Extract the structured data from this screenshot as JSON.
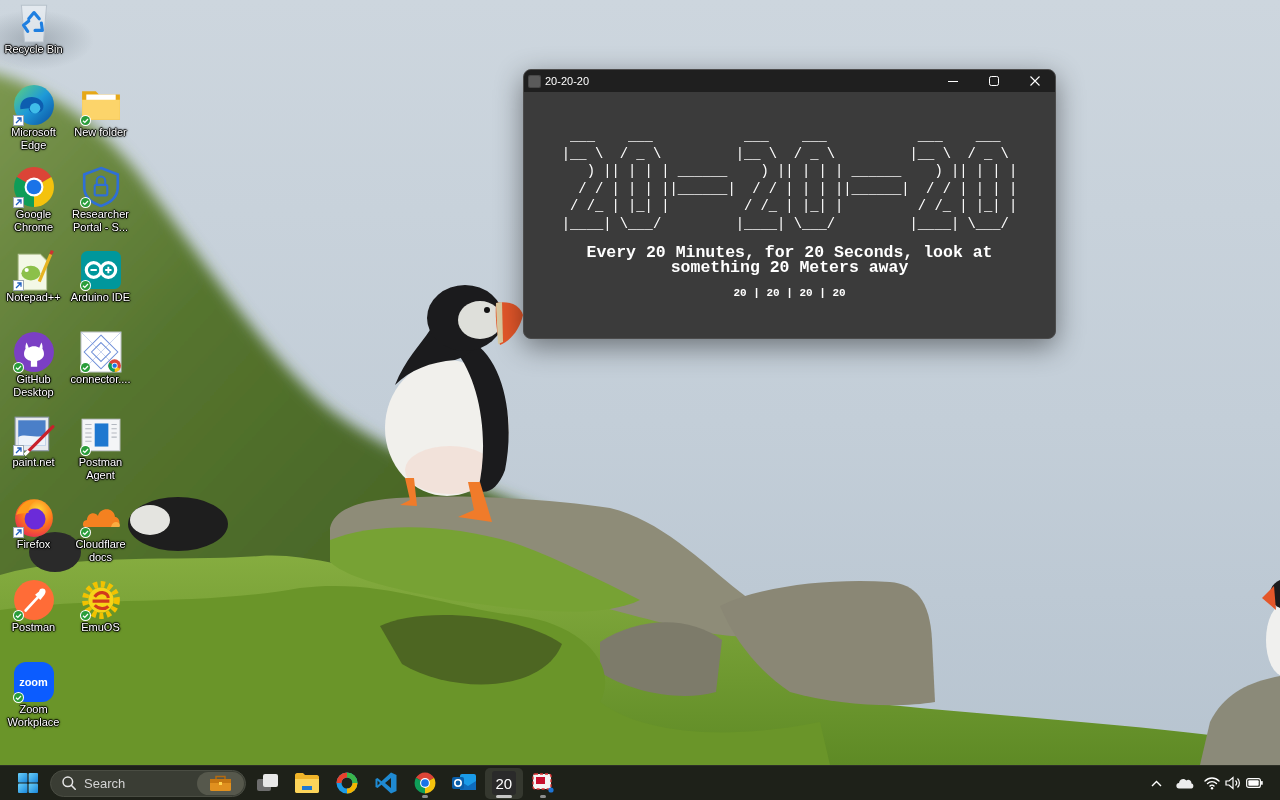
{
  "desktop": {
    "rows": [
      {
        "icons": [
          {
            "label": "Recycle Bin",
            "shortcut": false,
            "synced": false
          }
        ]
      },
      {
        "icons": [
          {
            "label": "Microsoft Edge",
            "shortcut": true,
            "synced": false
          },
          {
            "label": "New folder",
            "shortcut": false,
            "synced": true
          }
        ]
      },
      {
        "icons": [
          {
            "label": "Google Chrome",
            "shortcut": true,
            "synced": false
          },
          {
            "label": "Researcher Portal - S...",
            "shortcut": false,
            "synced": true
          }
        ]
      },
      {
        "icons": [
          {
            "label": "Notepad++",
            "shortcut": true,
            "synced": false
          },
          {
            "label": "Arduino IDE",
            "shortcut": false,
            "synced": true
          }
        ]
      },
      {
        "icons": [
          {
            "label": "GitHub Desktop",
            "shortcut": false,
            "synced": true
          },
          {
            "label": "connector....",
            "shortcut": false,
            "synced": true
          }
        ]
      },
      {
        "icons": [
          {
            "label": "paint.net",
            "shortcut": true,
            "synced": false
          },
          {
            "label": "Postman Agent",
            "shortcut": false,
            "synced": true
          }
        ]
      },
      {
        "icons": [
          {
            "label": "Firefox",
            "shortcut": true,
            "synced": false
          },
          {
            "label": "Cloudflare docs",
            "shortcut": false,
            "synced": true
          }
        ]
      },
      {
        "icons": [
          {
            "label": "Postman",
            "shortcut": false,
            "synced": true
          },
          {
            "label": "EmuOS",
            "shortcut": false,
            "synced": true
          }
        ]
      },
      {
        "icons": [
          {
            "label": "Zoom Workplace",
            "shortcut": false,
            "synced": true,
            "logo_text": "zoom"
          }
        ]
      }
    ]
  },
  "window": {
    "title": "20-20-20",
    "ascii_art": [
      " ___    ___           ___    ___           ___    ___",
      "|__ \\  / _ \\         |__ \\  / _ \\         |__ \\  / _ \\",
      "   ) || | | | ______    ) || | | | ______    ) || | | |",
      "  / / | | | ||______|  / / | | | ||______|  / / | | | |",
      " / /_ | |_| |         / /_ | |_| |         / /_ | |_| |",
      "|____| \\___/         |____| \\___/         |____| \\___/"
    ],
    "message": "Every 20 Minutes, for 20 Seconds, look at something 20 Meters away",
    "footer": "20 | 20 | 20 | 20"
  },
  "taskbar": {
    "search": {
      "placeholder": "Search"
    },
    "apps": [
      {
        "selected": false,
        "running": false
      },
      {
        "selected": false,
        "running": false
      },
      {
        "selected": false,
        "running": false
      },
      {
        "selected": false,
        "running": false
      },
      {
        "selected": false,
        "running": true
      },
      {
        "selected": false,
        "running": false
      },
      {
        "label": "20",
        "selected": true,
        "running": true
      },
      {
        "selected": false,
        "running": true
      }
    ]
  }
}
